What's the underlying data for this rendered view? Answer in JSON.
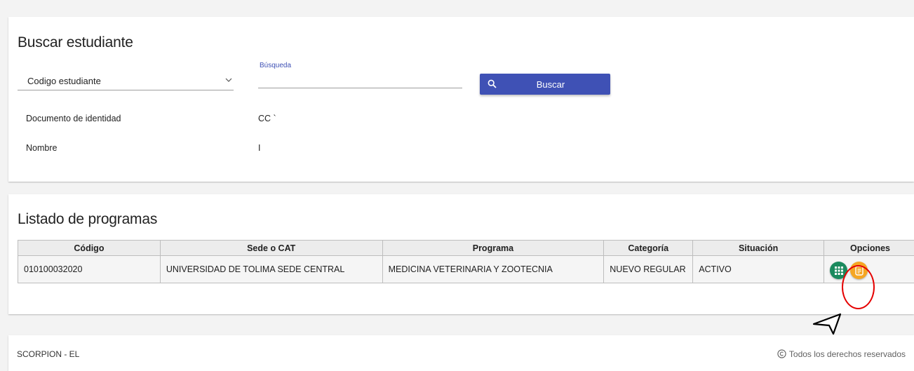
{
  "search": {
    "title": "Buscar estudiante",
    "select_value": "Codigo estudiante",
    "input_label": "Búsqueda",
    "input_value": "",
    "button_label": "Buscar",
    "document_label": "Documento de identidad",
    "document_value": "CC `",
    "name_label": "Nombre",
    "name_value": "I"
  },
  "programs": {
    "title": "Listado de programas",
    "headers": [
      "Código",
      "Sede o CAT",
      "Programa",
      "Categoría",
      "Situación",
      "Opciones"
    ],
    "rows": [
      {
        "codigo": "010100032020",
        "sede": "UNIVERSIDAD DE TOLIMA SEDE CENTRAL",
        "programa": "MEDICINA VETERINARIA Y ZOOTECNIA",
        "categoria": "NUEVO REGULAR",
        "situacion": "ACTIVO"
      }
    ]
  },
  "footer": {
    "left_text": "SCORPION - EL",
    "right_text": "Todos los derechos reservados"
  },
  "colors": {
    "primary": "#3f51b5",
    "grid_button": "#1b8a5e",
    "doc_button": "#f5a623",
    "annotation": "#e50000"
  }
}
